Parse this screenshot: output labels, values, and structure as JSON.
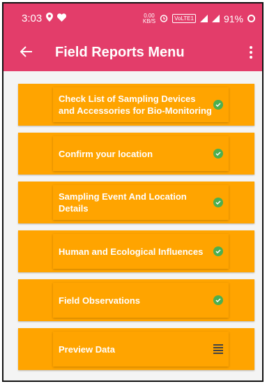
{
  "status_bar": {
    "time": "3:03",
    "data_speed_value": "0.00",
    "data_speed_unit": "KB/S",
    "volte": "VoLTE1",
    "battery": "91%"
  },
  "app_bar": {
    "title": "Field Reports Menu"
  },
  "colors": {
    "primary": "#e33d6a",
    "card": "#ffa400",
    "check": "#4caf50"
  },
  "items": [
    {
      "label": "Check List of Sampling Devices and Accessories for Bio-Monitoring",
      "status_icon": "check-circle-icon"
    },
    {
      "label": "Confirm your location",
      "status_icon": "check-circle-icon"
    },
    {
      "label": "Sampling Event And Location Details",
      "status_icon": "check-circle-icon"
    },
    {
      "label": "Human and Ecological Influences",
      "status_icon": "check-circle-icon"
    },
    {
      "label": "Field Observations",
      "status_icon": "check-circle-icon"
    },
    {
      "label": "Preview Data",
      "status_icon": "list-icon"
    }
  ]
}
